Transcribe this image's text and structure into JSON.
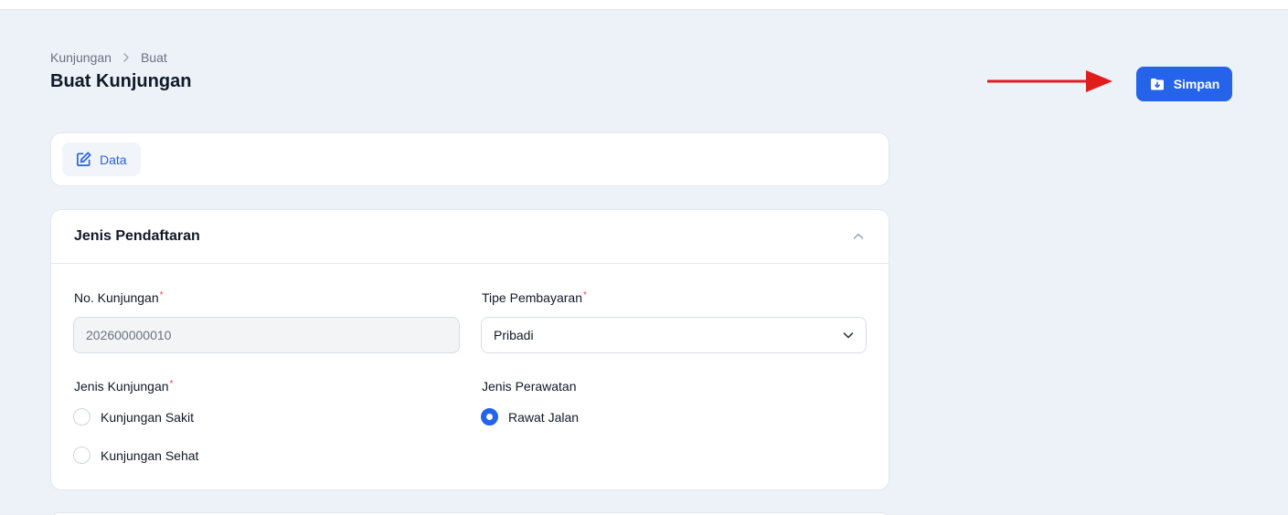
{
  "breadcrumb": {
    "parent": "Kunjungan",
    "current": "Buat"
  },
  "page": {
    "title": "Buat Kunjungan"
  },
  "toolbar": {
    "save_label": "Simpan"
  },
  "tabs": [
    {
      "label": "Data",
      "icon": "edit-icon"
    }
  ],
  "section": {
    "title": "Jenis Pendaftaran",
    "no_kunjungan": {
      "label": "No. Kunjungan",
      "required_mark": "*",
      "value": "202600000010"
    },
    "tipe_pembayaran": {
      "label": "Tipe Pembayaran",
      "required_mark": "*",
      "value": "Pribadi"
    },
    "jenis_kunjungan": {
      "label": "Jenis Kunjungan",
      "required_mark": "*",
      "options": [
        "Kunjungan Sakit",
        "Kunjungan Sehat"
      ]
    },
    "jenis_perawatan": {
      "label": "Jenis Perawatan",
      "options": [
        "Rawat Jalan"
      ],
      "selected": "Rawat Jalan"
    }
  },
  "colors": {
    "primary": "#2563eb",
    "background": "#edf1f8",
    "arrow": "#e11d1d",
    "required": "#ef4444"
  }
}
